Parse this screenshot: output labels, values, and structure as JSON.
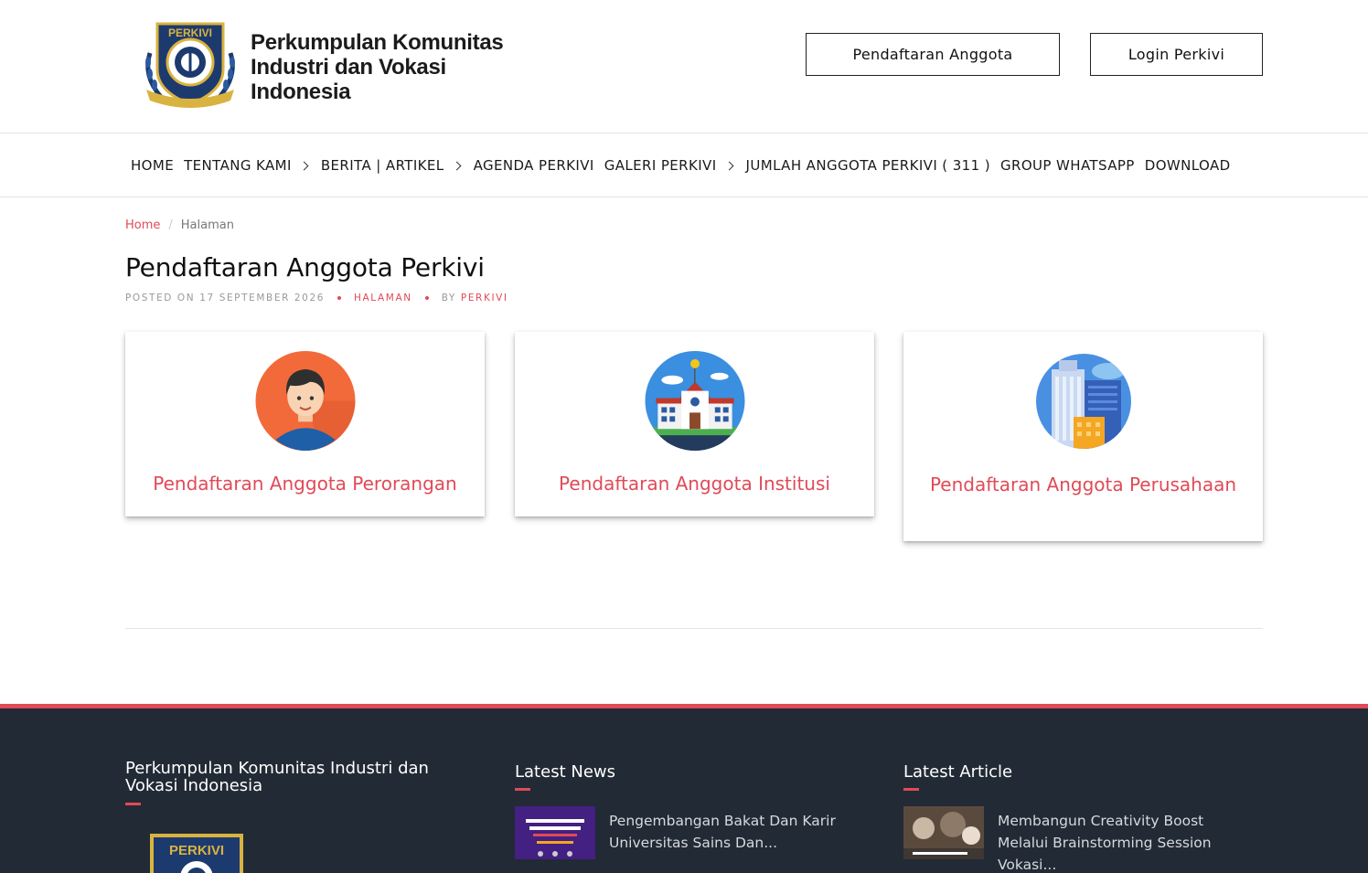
{
  "header": {
    "logo_text_lines": [
      "Perkumpulan Komunitas",
      "Industri dan Vokasi",
      "Indonesia"
    ],
    "logo_badge": "PERKIVI",
    "register_button": "Pendaftaran Anggota",
    "login_button": "Login Perkivi"
  },
  "nav": {
    "items": [
      {
        "label": "HOME",
        "has_submenu": false
      },
      {
        "label": "TENTANG KAMI",
        "has_submenu": true
      },
      {
        "label": "BERITA | ARTIKEL",
        "has_submenu": true
      },
      {
        "label": "AGENDA PERKIVI",
        "has_submenu": false
      },
      {
        "label": "GALERI PERKIVI",
        "has_submenu": true
      },
      {
        "label": "JUMLAH ANGGOTA PERKIVI ( 311 )",
        "has_submenu": false
      },
      {
        "label": "GROUP WHATSAPP",
        "has_submenu": false
      },
      {
        "label": "DOWNLOAD",
        "has_submenu": false
      }
    ]
  },
  "breadcrumb": {
    "home": "Home",
    "separator": "/",
    "current": "Halaman"
  },
  "page": {
    "title": "Pendaftaran Anggota Perkivi",
    "meta_posted": "POSTED ON 17 SEPTEMBER 2026",
    "meta_category": "HALAMAN",
    "meta_by": "BY",
    "meta_author": "PERKIVI"
  },
  "cards": [
    {
      "label": "Pendaftaran Anggota Perorangan",
      "icon": "person-avatar-icon"
    },
    {
      "label": "Pendaftaran Anggota Institusi",
      "icon": "school-building-icon"
    },
    {
      "label": "Pendaftaran Anggota Perusahaan",
      "icon": "office-building-icon"
    }
  ],
  "footer": {
    "about_title": "Perkumpulan Komunitas Industri dan Vokasi Indonesia",
    "logo_badge": "PERKIVI",
    "news_title": "Latest News",
    "news_item": "Pengembangan Bakat Dan Karir Universitas Sains Dan...",
    "article_title": "Latest Article",
    "article_item": "Membangun Creativity Boost Melalui Brainstorming Session Vokasi..."
  },
  "colors": {
    "accent": "#e04a57",
    "footer_bg": "#222a35",
    "navy": "#1d3a6e",
    "gold": "#d9b340"
  }
}
